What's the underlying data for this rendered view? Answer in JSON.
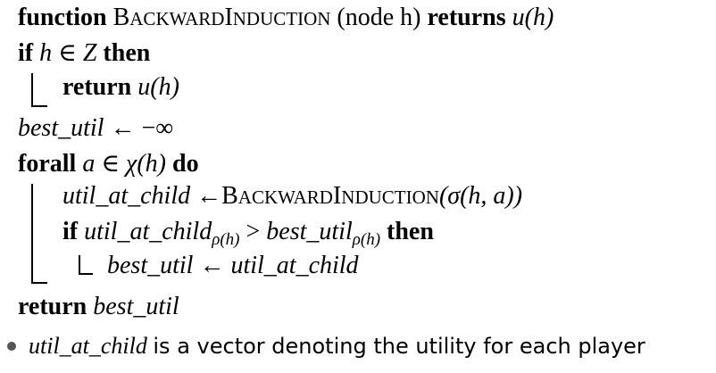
{
  "algorithm": {
    "header": {
      "kw_function": "function",
      "name_first": "B",
      "name_rest1": "ackward",
      "name_mid": "I",
      "name_rest2": "nduction",
      "param": "(node h)",
      "kw_returns": "returns",
      "ret": "u(h)"
    },
    "line_if": {
      "kw_if": "if",
      "cond": "h ∈ Z",
      "kw_then": "then"
    },
    "line_return_leaf": {
      "kw_return": "return",
      "expr": "u(h)"
    },
    "line_init": {
      "lhs": "best_util",
      "op": "←",
      "rhs": "−∞"
    },
    "line_forall": {
      "kw_forall": "forall",
      "cond": "a ∈ χ(h)",
      "kw_do": "do"
    },
    "line_assign_child": {
      "lhs": "util_at_child",
      "op": "←",
      "call_first": "B",
      "call_rest1": "ackward",
      "call_mid": "I",
      "call_rest2": "nduction",
      "args": "(σ(h, a))"
    },
    "line_if_better": {
      "kw_if": "if",
      "lhs": "util_at_child",
      "lhs_sub": "ρ(h)",
      "op": ">",
      "rhs": "best_util",
      "rhs_sub": "ρ(h)",
      "kw_then": "then"
    },
    "line_update": {
      "lhs": "best_util",
      "op": "←",
      "rhs": "util_at_child"
    },
    "line_return_best": {
      "kw_return": "return",
      "expr": "best_util"
    }
  },
  "note": {
    "math": "util_at_child",
    "text": "is a vector denoting the utility for each player"
  }
}
